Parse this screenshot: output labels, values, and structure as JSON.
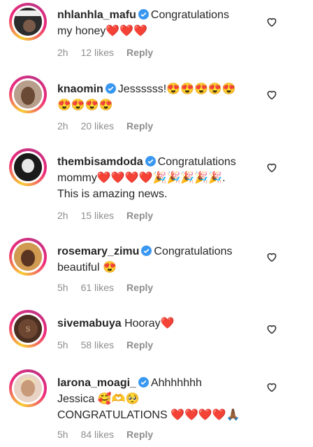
{
  "comments": [
    {
      "username": "nhlanhla_mafu",
      "verified": true,
      "line1": "Congratulations",
      "line2": "my honey❤️❤️❤️",
      "line3": "",
      "time": "2h",
      "likes": "12 likes",
      "reply": "Reply",
      "avatar_color": "#3a3a3a"
    },
    {
      "username": "knaomin",
      "verified": true,
      "line1": "Jessssss!😍😍😍😍😍",
      "line2": "😍😍😍😍",
      "line3": "",
      "time": "2h",
      "likes": "20 likes",
      "reply": "Reply",
      "avatar_color": "#8a6a55"
    },
    {
      "username": "thembisamdoda",
      "verified": true,
      "line1": "Congratulations",
      "line2": "mommy❤️❤️❤️❤️🎉🎉🎉🎉🎉.",
      "line3": "This is amazing news.",
      "time": "2h",
      "likes": "15 likes",
      "reply": "Reply",
      "avatar_color": "#1e1e1e"
    },
    {
      "username": "rosemary_zimu",
      "verified": true,
      "line1": "Congratulations",
      "line2": "beautiful 😍",
      "line3": "",
      "time": "5h",
      "likes": "61 likes",
      "reply": "Reply",
      "avatar_color": "#b07a45"
    },
    {
      "username": "sivemabuya",
      "verified": false,
      "line1": "Hooray❤️",
      "line2": "",
      "line3": "",
      "time": "5h",
      "likes": "58 likes",
      "reply": "Reply",
      "avatar_color": "#5a3a2a"
    },
    {
      "username": "larona_moagi_",
      "verified": true,
      "line1": "Ahhhhhhh",
      "line2": "Jessica 🥰🫶🥺",
      "line3": "CONGRATULATIONS ❤️❤️❤️❤️🙏🏾",
      "time": "5h",
      "likes": "84 likes",
      "reply": "Reply",
      "avatar_color": "#d9b8a0"
    }
  ],
  "colors": {
    "text": "#262626",
    "meta": "#8e8e8e",
    "verified": "#3897f0"
  },
  "icons": {
    "verified": "verified-badge-icon",
    "like": "heart-outline-icon"
  }
}
